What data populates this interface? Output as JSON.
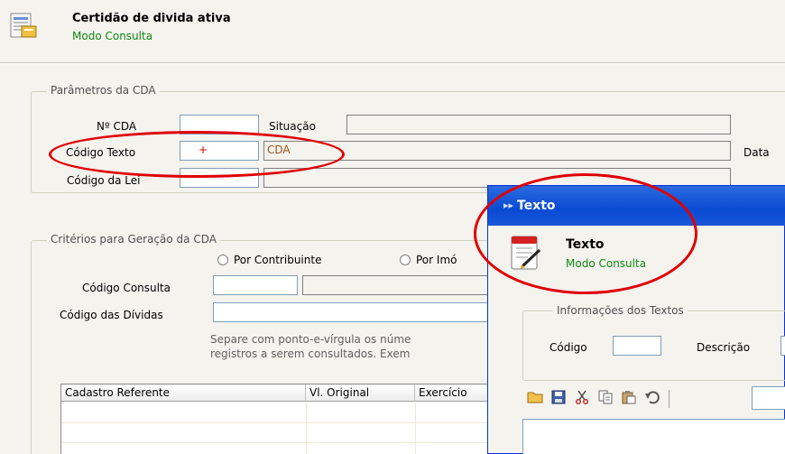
{
  "header": {
    "title": "Certidão de divida ativa",
    "subtitle": "Modo Consulta",
    "icon": "document-list-icon"
  },
  "params": {
    "legend": "Parâmetros da CDA",
    "nr_cda_label": "Nº CDA",
    "situacao_label": "Situação",
    "codigo_texto_label": "Código Texto",
    "codigo_texto_value": "+",
    "codigo_texto_desc": "CDA",
    "data_label": "Data",
    "codigo_lei_label": "Código da Lei"
  },
  "criteria": {
    "legend": "Critérios para Geração da CDA",
    "radio_contribuinte": "Por Contribuinte",
    "radio_imovel": "Por Imó",
    "codigo_consulta_label": "Código Consulta",
    "codigo_dividas_label": "Código das Dívidas",
    "hint_line1": "Separe com ponto-e-vírgula os núme",
    "hint_line2": "registros a serem consultados. Exem"
  },
  "table": {
    "columns": [
      "Cadastro Referente",
      "Vl. Original",
      "Exercício"
    ]
  },
  "dialog": {
    "window_title": "Texto",
    "title": "Texto",
    "subtitle": "Modo Consulta",
    "group_legend": "Informações dos Textos",
    "codigo_label": "Código",
    "descricao_label": "Descrição",
    "toolbar": [
      "open-folder-icon",
      "save-icon",
      "cut-icon",
      "copy-icon",
      "paste-icon",
      "undo-icon"
    ]
  },
  "colors": {
    "subtitle_green": "#118811",
    "dialog_titlebar": "#0a4bd3",
    "annotation_red": "#e00000",
    "background": "#f4f3ee"
  }
}
